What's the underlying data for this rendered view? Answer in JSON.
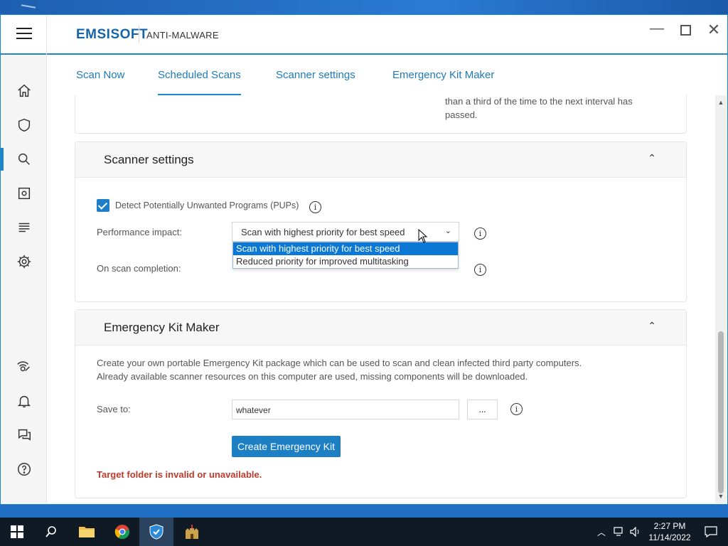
{
  "app": {
    "brand": "EMSISOFT",
    "product": "ANTI-MALWARE"
  },
  "window_controls": {
    "minimize": "—",
    "close": "✕"
  },
  "sidebar": {
    "items": [
      {
        "name": "home",
        "icon": "home-icon"
      },
      {
        "name": "protection",
        "icon": "shield-icon"
      },
      {
        "name": "scan",
        "icon": "search-icon",
        "active": true
      },
      {
        "name": "quarantine",
        "icon": "quarantine-icon"
      },
      {
        "name": "logs",
        "icon": "logs-icon"
      },
      {
        "name": "settings",
        "icon": "gear-icon"
      },
      {
        "name": "connection",
        "icon": "connection-icon"
      },
      {
        "name": "notifications",
        "icon": "bell-icon"
      },
      {
        "name": "feedback",
        "icon": "chat-icon"
      },
      {
        "name": "help",
        "icon": "help-icon"
      }
    ]
  },
  "tabs": [
    {
      "label": "Scan Now"
    },
    {
      "label": "Scheduled Scans",
      "active": true
    },
    {
      "label": "Scanner settings"
    },
    {
      "label": "Emergency Kit Maker"
    }
  ],
  "previous_card": {
    "text_line1": "than a third of the time to the next interval has",
    "text_line2": "passed."
  },
  "scanner_settings": {
    "title": "Scanner settings",
    "collapse_icon": "⌃",
    "pup_label": "Detect Potentially Unwanted Programs (PUPs)",
    "pup_checked": true,
    "performance_label": "Performance impact:",
    "performance_value": "Scan with highest priority for best speed",
    "performance_options": [
      "Scan with highest priority for best speed",
      "Reduced priority for improved multitasking"
    ],
    "completion_label": "On scan completion:"
  },
  "emergency_kit": {
    "title": "Emergency Kit Maker",
    "collapse_icon": "⌃",
    "desc_line1": "Create your own portable Emergency Kit package which can be used to scan and clean infected third party computers.",
    "desc_line2": "Already available scanner resources on this computer are used, missing components will be downloaded.",
    "save_label": "Save to:",
    "save_value": "whatever",
    "browse_label": "...",
    "create_button": "Create Emergency Kit",
    "error": "Target folder is invalid or unavailable."
  },
  "info_glyph": "i",
  "taskbar": {
    "time": "2:27 PM",
    "date": "11/14/2022"
  },
  "colors": {
    "accent": "#1f86c8",
    "error": "#c0392b",
    "selected_option": "#0a78d4"
  }
}
